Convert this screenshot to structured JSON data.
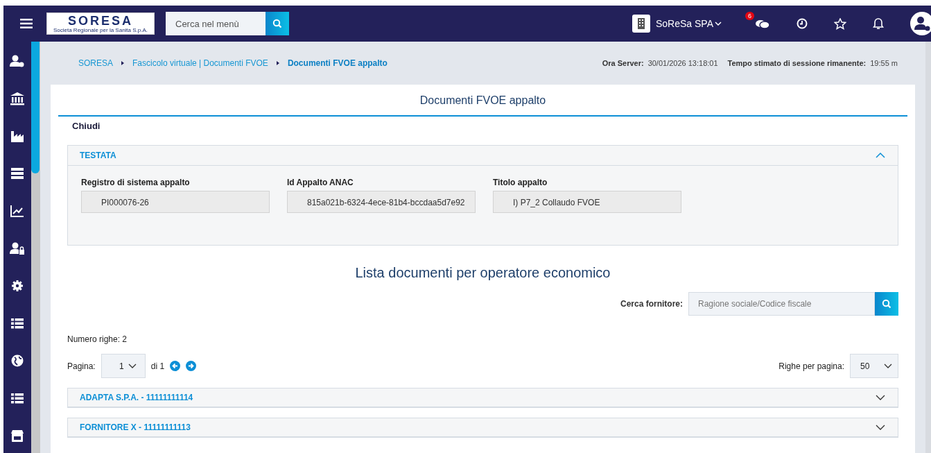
{
  "header": {
    "logo": {
      "title": "SORESA",
      "subtitle": "Societa Regionale per la Sanita S.p.A."
    },
    "search": {
      "placeholder": "Cerca nel menù"
    },
    "company": "SoReSa SPA",
    "messages_badge": "6"
  },
  "breadcrumb": [
    {
      "label": "SORESA",
      "current": false
    },
    {
      "label": "Fascicolo virtuale | Documenti FVOE",
      "current": false
    },
    {
      "label": "Documenti FVOE appalto",
      "current": true
    }
  ],
  "server": {
    "label": "Ora Server:",
    "value": "30/01/2026 13:18:01",
    "session_label": "Tempo stimato di sessione rimanente:",
    "session_value": "19:55 m"
  },
  "page_title": "Documenti FVOE appalto",
  "close": "Chiudi",
  "header_panel": {
    "title": "TESTATA",
    "expanded": true,
    "fields": [
      {
        "label": "Registro di sistema appalto",
        "value": "PI000076-26"
      },
      {
        "label": "Id Appalto ANAC",
        "value": "815a021b-6324-4ece-81b4-bccdaa5d7e92"
      },
      {
        "label": "Titolo appalto",
        "value": "I) P7_2 Collaudo FVOE"
      }
    ]
  },
  "list_title": "Lista documenti per operatore economico",
  "supplier_search": {
    "label": "Cerca fornitore:",
    "placeholder": "Ragione sociale/Codice fiscale"
  },
  "row_count": "Numero righe: 2",
  "pager": {
    "label": "Pagina:",
    "page": "1",
    "of": "di 1",
    "rows_label": "Righe per pagina:",
    "rows": "50"
  },
  "suppliers": [
    {
      "label": "ADAPTA S.P.A. - 11111111114",
      "expanded": false
    },
    {
      "label": "FORNITORE X - 11111111113",
      "expanded": false
    }
  ]
}
